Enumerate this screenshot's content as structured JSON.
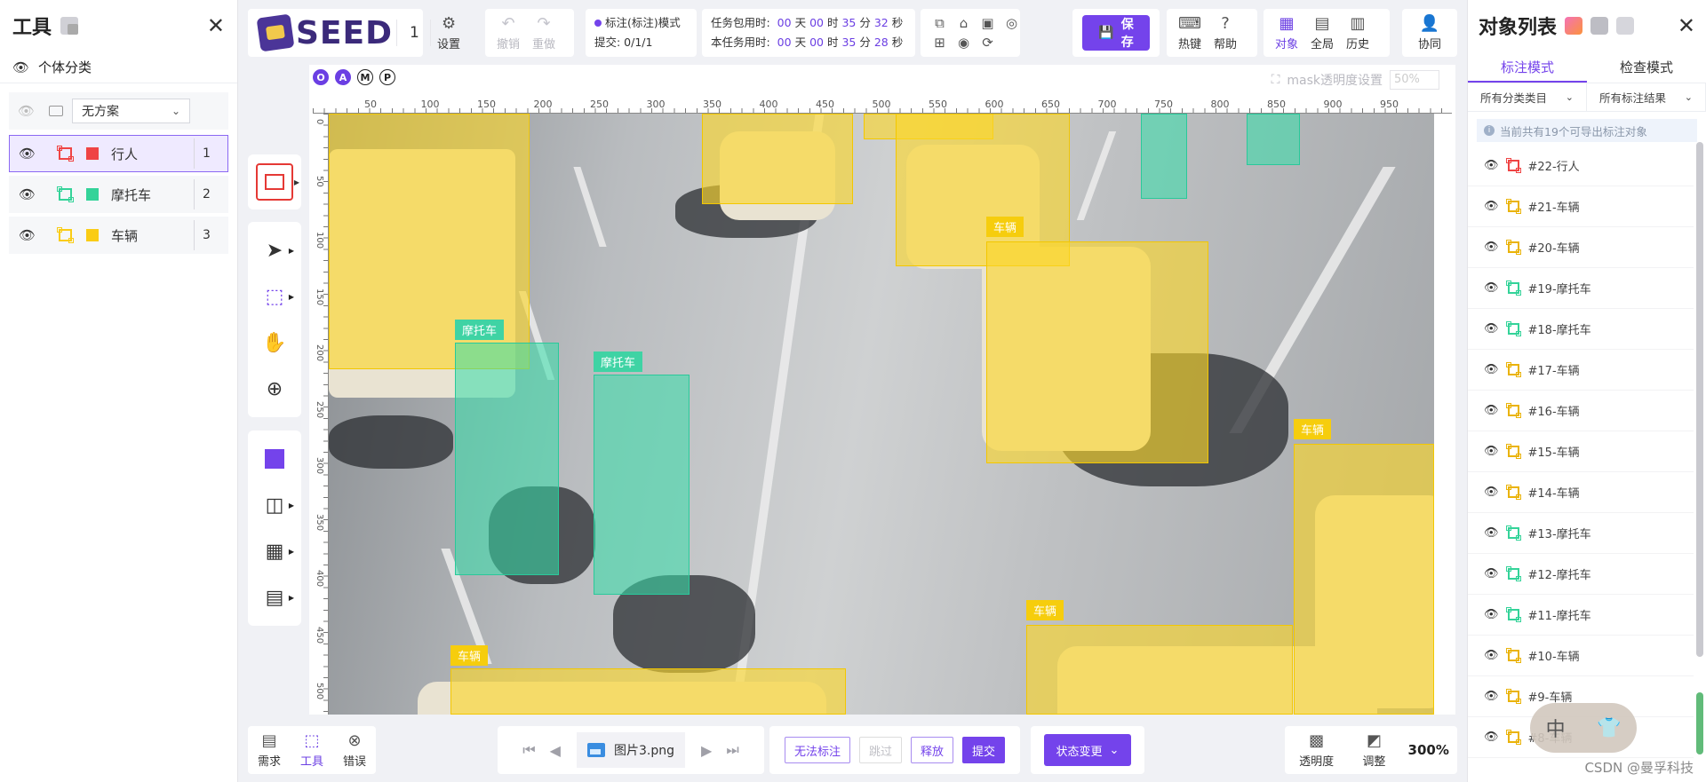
{
  "left_panel": {
    "title": "工具",
    "individual_label": "个体分类",
    "scheme_select": "无方案",
    "classes": [
      {
        "label": "行人",
        "number": "1",
        "color": "#ef4444"
      },
      {
        "label": "摩托车",
        "number": "2",
        "color": "#34d399"
      },
      {
        "label": "车辆",
        "number": "3",
        "color": "#facc15"
      }
    ]
  },
  "toolbar": {
    "logo_text": "SEED",
    "job_count": "1",
    "settings_label": "设置",
    "undo_label": "撤销",
    "redo_label": "重做",
    "mode_text": "标注(标注)模式",
    "submit_progress": "提交: 0/1/1",
    "timers": {
      "package_label": "任务包用时:",
      "package_days": "00",
      "package_hours": "00",
      "package_minutes": "35",
      "package_seconds": "32",
      "task_label": "本任务用时:",
      "task_days": "00",
      "task_hours": "00",
      "task_minutes": "35",
      "task_seconds": "28",
      "unit_day": "天",
      "unit_hour": "时",
      "unit_minute": "分",
      "unit_second": "秒"
    },
    "save_label": "保存",
    "hotkey_label": "热键",
    "help_label": "帮助",
    "object_label": "对象",
    "global_label": "全局",
    "history_label": "历史",
    "collab_label": "协同"
  },
  "canvas": {
    "option_circles": [
      "O",
      "A",
      "M",
      "P"
    ],
    "mask_setting_label": "mask透明度设置",
    "mask_opacity": "50%",
    "ruler_h_ticks": [
      "50",
      "100",
      "150",
      "200",
      "250",
      "300",
      "350",
      "400",
      "450",
      "500",
      "550",
      "600",
      "650",
      "700",
      "750",
      "800",
      "850",
      "900",
      "950"
    ],
    "ruler_v_ticks": [
      "0",
      "50",
      "100",
      "150",
      "200",
      "250",
      "300",
      "350",
      "400",
      "450",
      "500"
    ],
    "label_vehicle": "车辆",
    "label_moto": "摩托车"
  },
  "bottom": {
    "requirement_label": "需求",
    "tools_label": "工具",
    "error_label": "错误",
    "image_name": "图片3.png",
    "cannot_annotate": "无法标注",
    "skip": "跳过",
    "release": "释放",
    "submit": "提交",
    "state_change": "状态变更",
    "transparency_label": "透明度",
    "adjust_label": "调整",
    "zoom": "300%"
  },
  "right_panel": {
    "title": "对象列表",
    "tab_annotate": "标注模式",
    "tab_inspect": "检查模式",
    "filter_category": "所有分类类目",
    "filter_result": "所有标注结果",
    "notice": "当前共有19个可导出标注对象",
    "objects": [
      {
        "label": "#22-行人",
        "color": "#ef4444"
      },
      {
        "label": "#21-车辆",
        "color": "#eab308"
      },
      {
        "label": "#20-车辆",
        "color": "#eab308"
      },
      {
        "label": "#19-摩托车",
        "color": "#34d399"
      },
      {
        "label": "#18-摩托车",
        "color": "#34d399"
      },
      {
        "label": "#17-车辆",
        "color": "#eab308"
      },
      {
        "label": "#16-车辆",
        "color": "#eab308"
      },
      {
        "label": "#15-车辆",
        "color": "#eab308"
      },
      {
        "label": "#14-车辆",
        "color": "#eab308"
      },
      {
        "label": "#13-摩托车",
        "color": "#34d399"
      },
      {
        "label": "#12-摩托车",
        "color": "#34d399"
      },
      {
        "label": "#11-摩托车",
        "color": "#34d399"
      },
      {
        "label": "#10-车辆",
        "color": "#eab308"
      },
      {
        "label": "#9-车辆",
        "color": "#eab308"
      },
      {
        "label": "#8-车辆",
        "color": "#eab308"
      }
    ]
  },
  "watermark": "CSDN @曼孚科技",
  "ime_char": "中"
}
